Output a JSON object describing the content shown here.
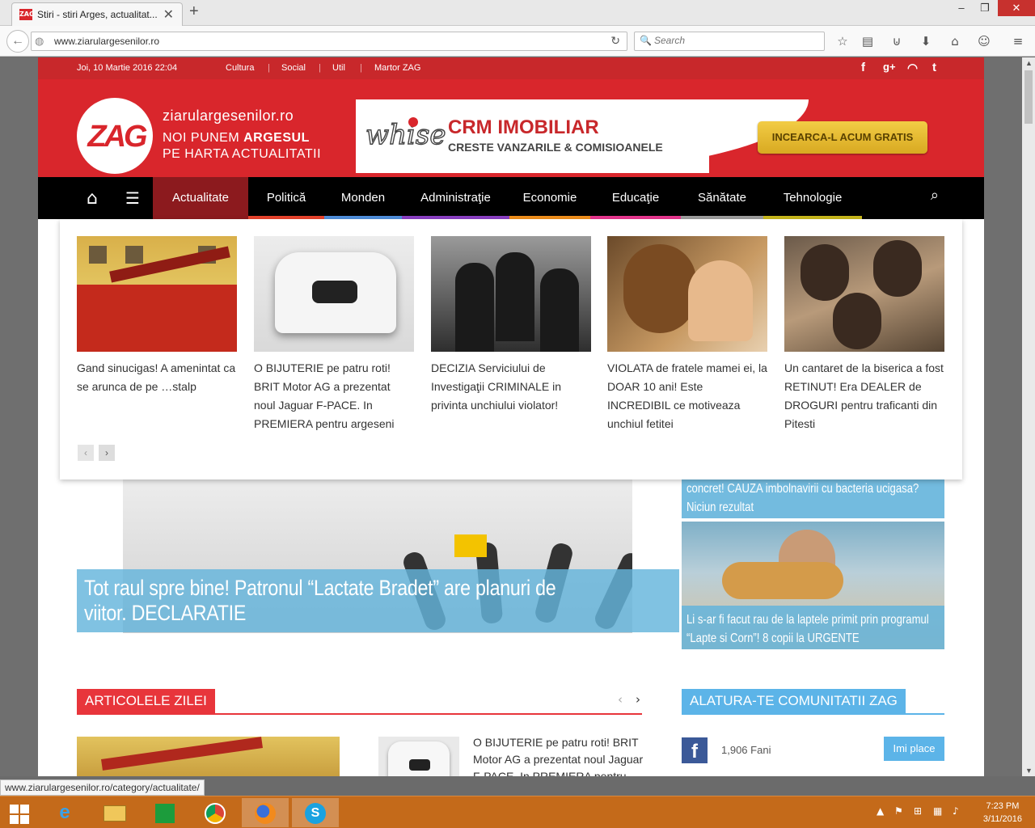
{
  "browser": {
    "tab_title": "Stiri - stiri Arges, actualitat...",
    "tab_favicon_text": "ZAG",
    "url": "www.ziarulargesenilor.ro",
    "search_placeholder": "Search",
    "status_url": "www.ziarulargesenilor.ro/category/actualitate/"
  },
  "topstrip": {
    "date": "Joi, 10 Martie 2016 22:04",
    "links": [
      "Cultura",
      "Social",
      "Util",
      "Martor ZAG"
    ],
    "social_icons": [
      "facebook-icon",
      "google-plus-icon",
      "rss-icon",
      "twitter-icon"
    ],
    "social_glyphs": [
      "f",
      "g+",
      "◠",
      "t"
    ]
  },
  "header": {
    "logo_text": "ZAG",
    "site_name": "ziarulargesenilor.ro",
    "slogan_line1_pre": "NOI PUNEM ",
    "slogan_line1_bold": "ARGESUL",
    "slogan_line2": "PE HARTA ACTUALITATII"
  },
  "ad": {
    "brand": "whise",
    "title": "CRM IMOBILIAR",
    "subtitle": "CRESTE VANZARILE & COMISIOANELE",
    "cta": "INCEARCA-L ACUM GRATIS"
  },
  "nav": {
    "items": [
      {
        "label": "Actualitate",
        "color": "#8c1a1e"
      },
      {
        "label": "Politică",
        "color": "#e8432c"
      },
      {
        "label": "Monden",
        "color": "#4f8fdc"
      },
      {
        "label": "Administraţie",
        "color": "#8b3fc4"
      },
      {
        "label": "Economie",
        "color": "#f08f1c"
      },
      {
        "label": "Educaţie",
        "color": "#e8368f"
      },
      {
        "label": "Sănătate",
        "color": "#9e9e9e"
      },
      {
        "label": "Tehnologie",
        "color": "#c8b81c"
      }
    ]
  },
  "mega": {
    "cards": [
      {
        "title": "Gand sinucigas! A amenintat ca se arunca de pe …stalp"
      },
      {
        "title": "O BIJUTERIE pe patru roti! BRIT Motor AG a prezentat noul Jaguar F-PACE. In PREMIERA pentru argeseni"
      },
      {
        "title": "DECIZIA Serviciului de Investigaţii CRIMINALE in privinta unchiului violator!"
      },
      {
        "title": "VIOLATA de fratele mamei ei, la DOAR 10 ani! Este INCREDIBIL ce motiveaza unchiul fetitei"
      },
      {
        "title": "Un cantaret de la biserica a fost RETINUT! Era DEALER de DROGURI pentru traficanti din Pitesti"
      }
    ],
    "prev": "‹",
    "next": "›"
  },
  "featured": {
    "hero_caption": "Tot raul spre bine! Patronul “Lactate Bradet” are planuri de viitor. DECLARATIE",
    "side1": "concret! CAUZA imbolnavirii cu bacteria ucigasa? Niciun rezultat",
    "side2": "Li s-ar fi facut rau de la laptele primit prin programul “Lapte si Corn”! 8 copii la URGENTE"
  },
  "articole": {
    "heading": "ARTICOLELE ZILEI",
    "prev": "‹",
    "next": "›",
    "item_text": "O BIJUTERIE pe patru roti! BRIT Motor AG a prezentat noul Jaguar F-PACE. In PREMIERA pentru argeseni"
  },
  "community": {
    "heading": "ALATURA-TE COMUNITATII ZAG",
    "fb_count": "1,906",
    "fb_label": "Fani",
    "like_button": "Imi place"
  },
  "taskbar": {
    "time": "7:23 PM",
    "date": "3/11/2016"
  }
}
